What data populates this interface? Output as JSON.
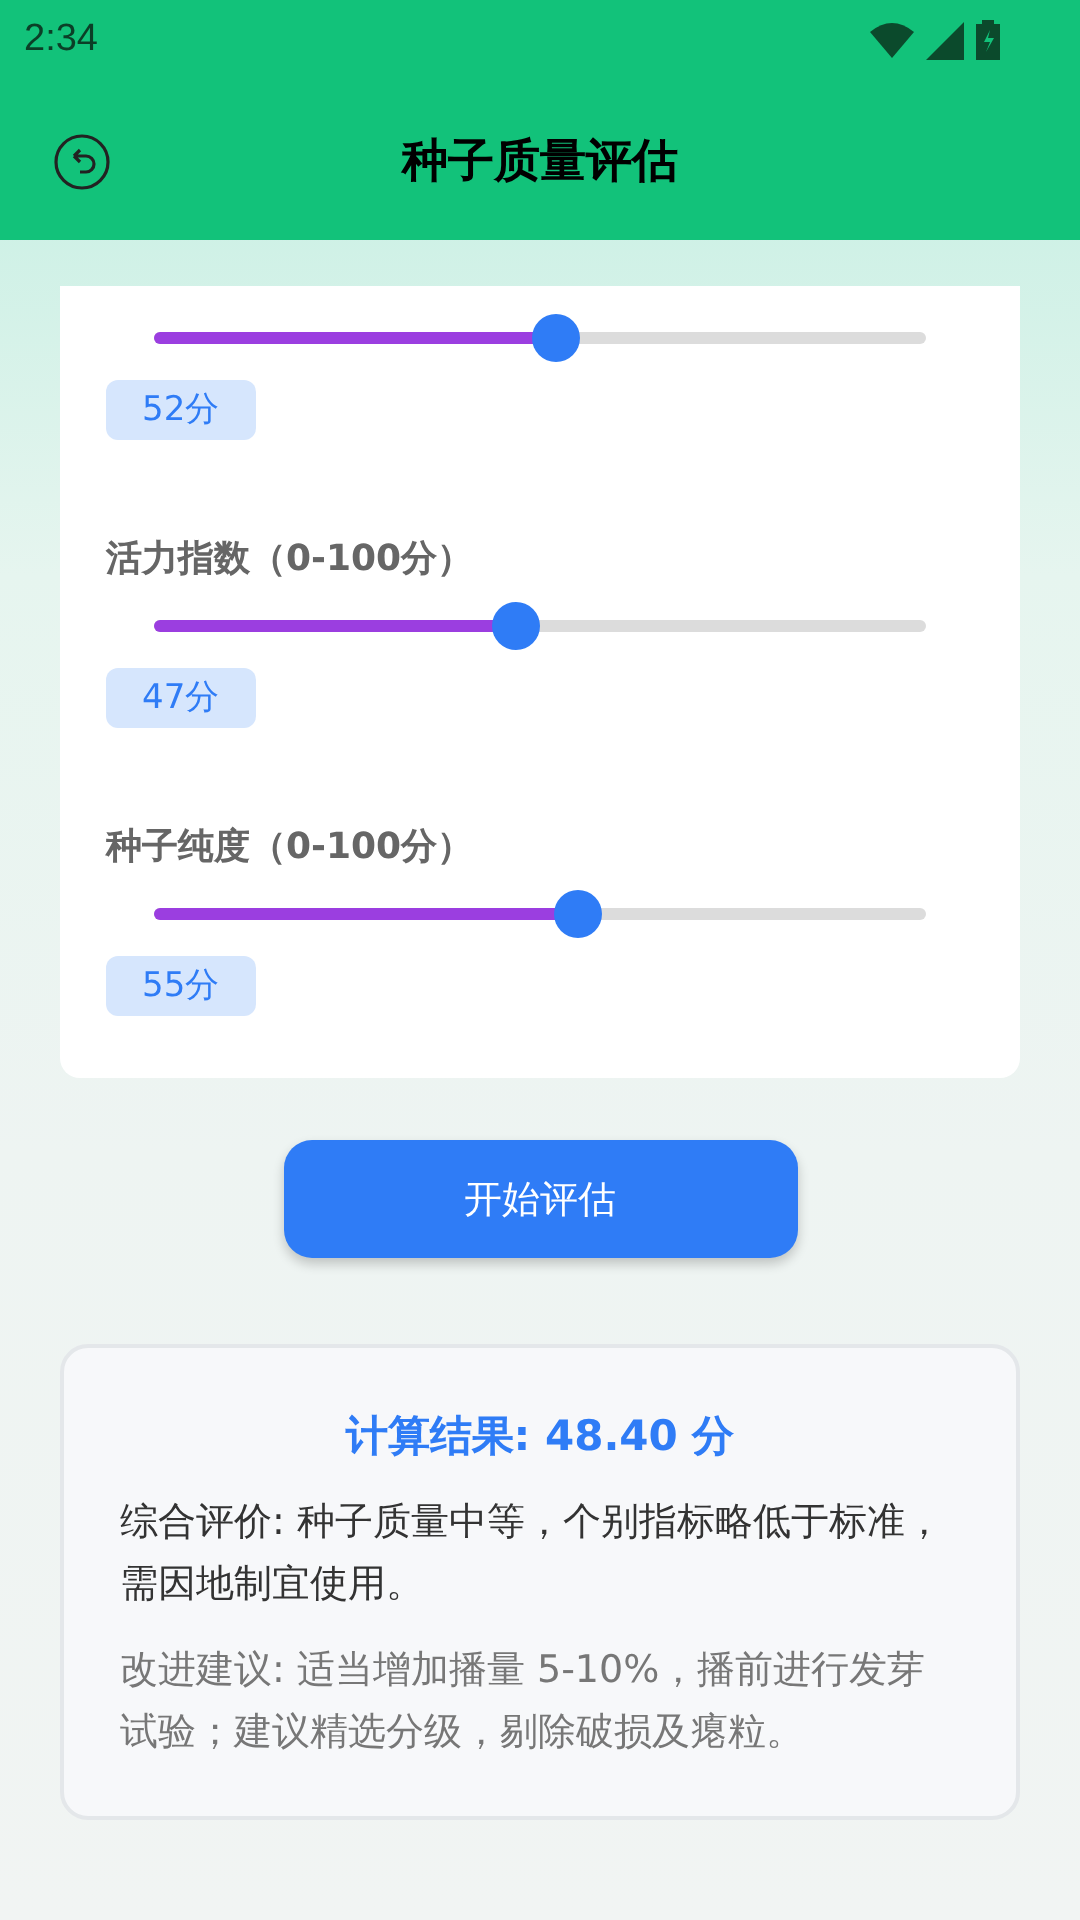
{
  "status_bar": {
    "time": "2:34"
  },
  "app_bar": {
    "title": "种子质量评估"
  },
  "sliders": [
    {
      "level": 0.52,
      "value": "52分"
    },
    {
      "label": "活力指数（0-100分）",
      "level": 0.47,
      "value": "47分"
    },
    {
      "label": "种子纯度（0-100分）",
      "level": 0.55,
      "value": "55分"
    }
  ],
  "button": "开始评估",
  "result": {
    "title": "计算结果: 48.40 分",
    "evaluation": "综合评价: 种子质量中等，个别指标略低于标准，需因地制宜使用。",
    "advice": "改进建议: 适当增加播量 5-10%，播前进行发芽试验；建议精选分级，剔除破损及瘪粒。"
  }
}
